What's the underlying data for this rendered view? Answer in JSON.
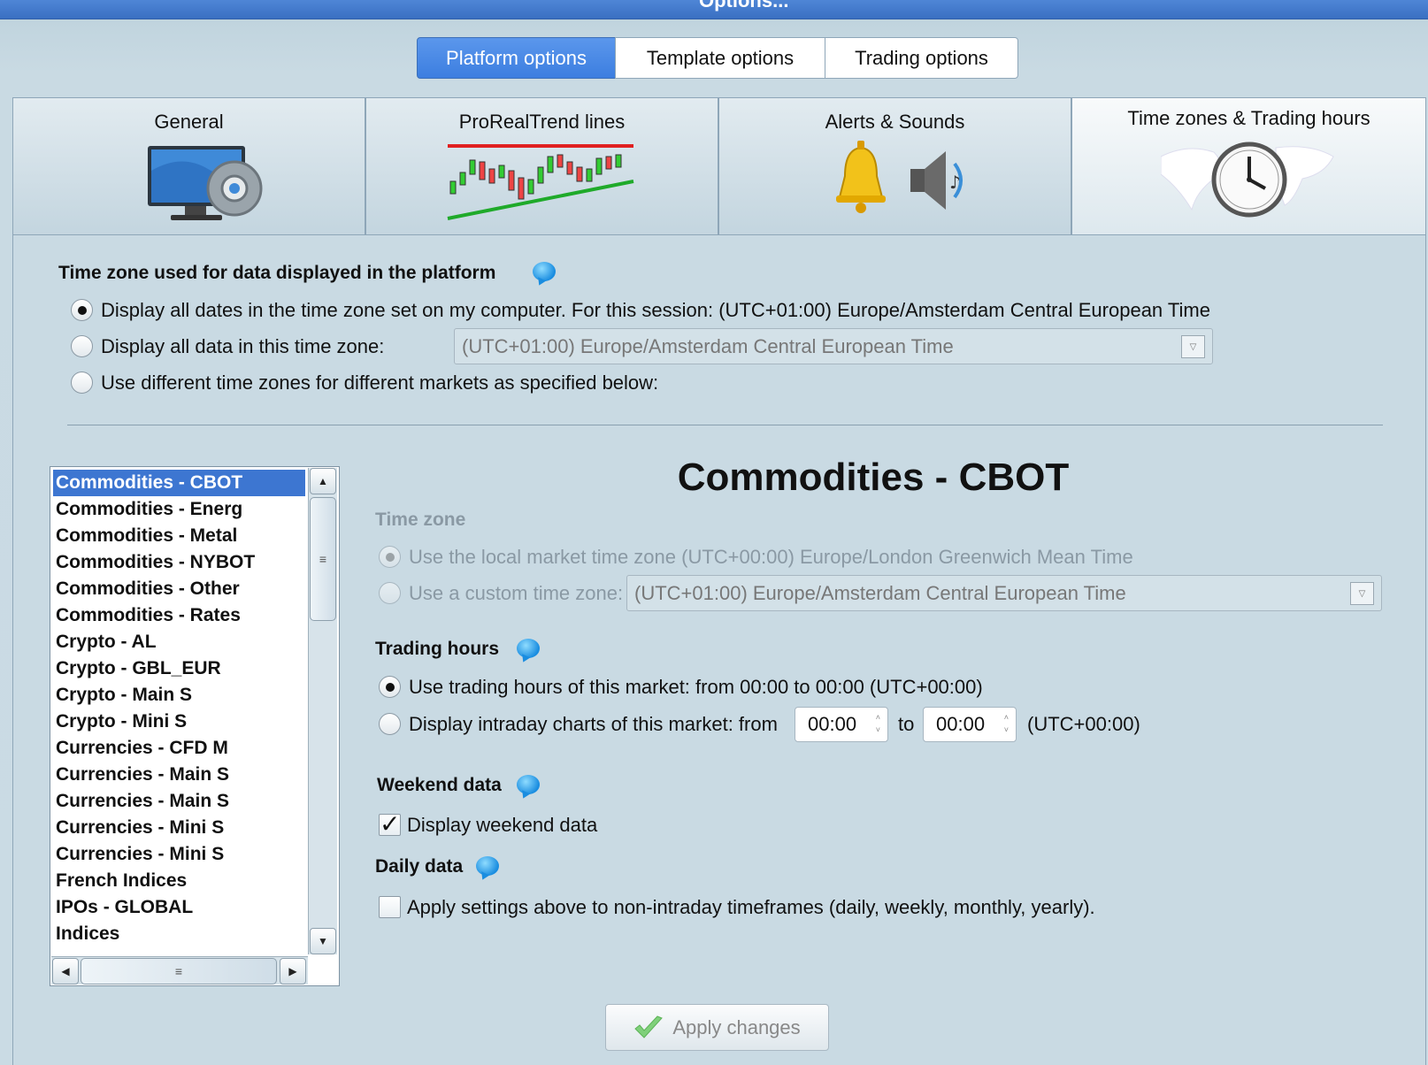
{
  "window": {
    "title": "Options..."
  },
  "top_tabs": [
    "Platform options",
    "Template options",
    "Trading options"
  ],
  "category_tabs": [
    {
      "label": "General",
      "icon": "monitor-gear-icon"
    },
    {
      "label": "ProRealTrend lines",
      "icon": "candlestick-trend-icon"
    },
    {
      "label": "Alerts & Sounds",
      "icon": "bell-speaker-icon"
    },
    {
      "label": "Time zones & Trading hours",
      "icon": "world-clock-icon"
    }
  ],
  "timezone_section": {
    "heading": "Time zone used for data displayed in the platform",
    "option1": "Display all dates in the time zone set on my computer. For this session:  (UTC+01:00) Europe/Amsterdam Central European Time",
    "option2": "Display all data in this time zone:",
    "option2_combo": "(UTC+01:00) Europe/Amsterdam Central European Time",
    "option3": "Use different time zones for different markets as specified below:",
    "selected": 1
  },
  "markets": {
    "items": [
      "Commodities - CBOT",
      "Commodities - Energ",
      "Commodities - Metal",
      "Commodities - NYBOT",
      "Commodities - Other",
      "Commodities - Rates",
      "Crypto - AL",
      "Crypto - GBL_EUR",
      "Crypto - Main S",
      "Crypto - Mini S",
      "Currencies - CFD M",
      "Currencies - Main S",
      "Currencies - Main S",
      "Currencies - Mini S",
      "Currencies - Mini S",
      "French Indices",
      "IPOs - GLOBAL",
      "Indices"
    ],
    "selected_index": 0
  },
  "detail": {
    "title": "Commodities - CBOT",
    "time_zone_heading": "Time zone",
    "tz_local": "Use the local market time zone (UTC+00:00) Europe/London Greenwich Mean Time",
    "tz_custom": "Use a custom time zone:",
    "tz_custom_combo": "(UTC+01:00) Europe/Amsterdam Central European Time",
    "trading_hours_heading": "Trading hours",
    "th_market": "Use trading hours of this market: from 00:00 to 00:00  (UTC+00:00)",
    "th_intraday": "Display intraday charts of this market:  from",
    "th_from": "00:00",
    "th_to_label": "to",
    "th_to": "00:00",
    "th_tz": "(UTC+00:00)",
    "weekend_heading": "Weekend data",
    "weekend_label": "Display weekend data",
    "weekend_checked": true,
    "daily_heading": "Daily data",
    "daily_label": "Apply settings above to non-intraday timeframes (daily, weekly, monthly, yearly).",
    "daily_checked": false
  },
  "apply_button": "Apply changes",
  "colors": {
    "accent": "#3d76d1",
    "background": "#c9dae3",
    "info_bubble": "#1a8de0"
  }
}
